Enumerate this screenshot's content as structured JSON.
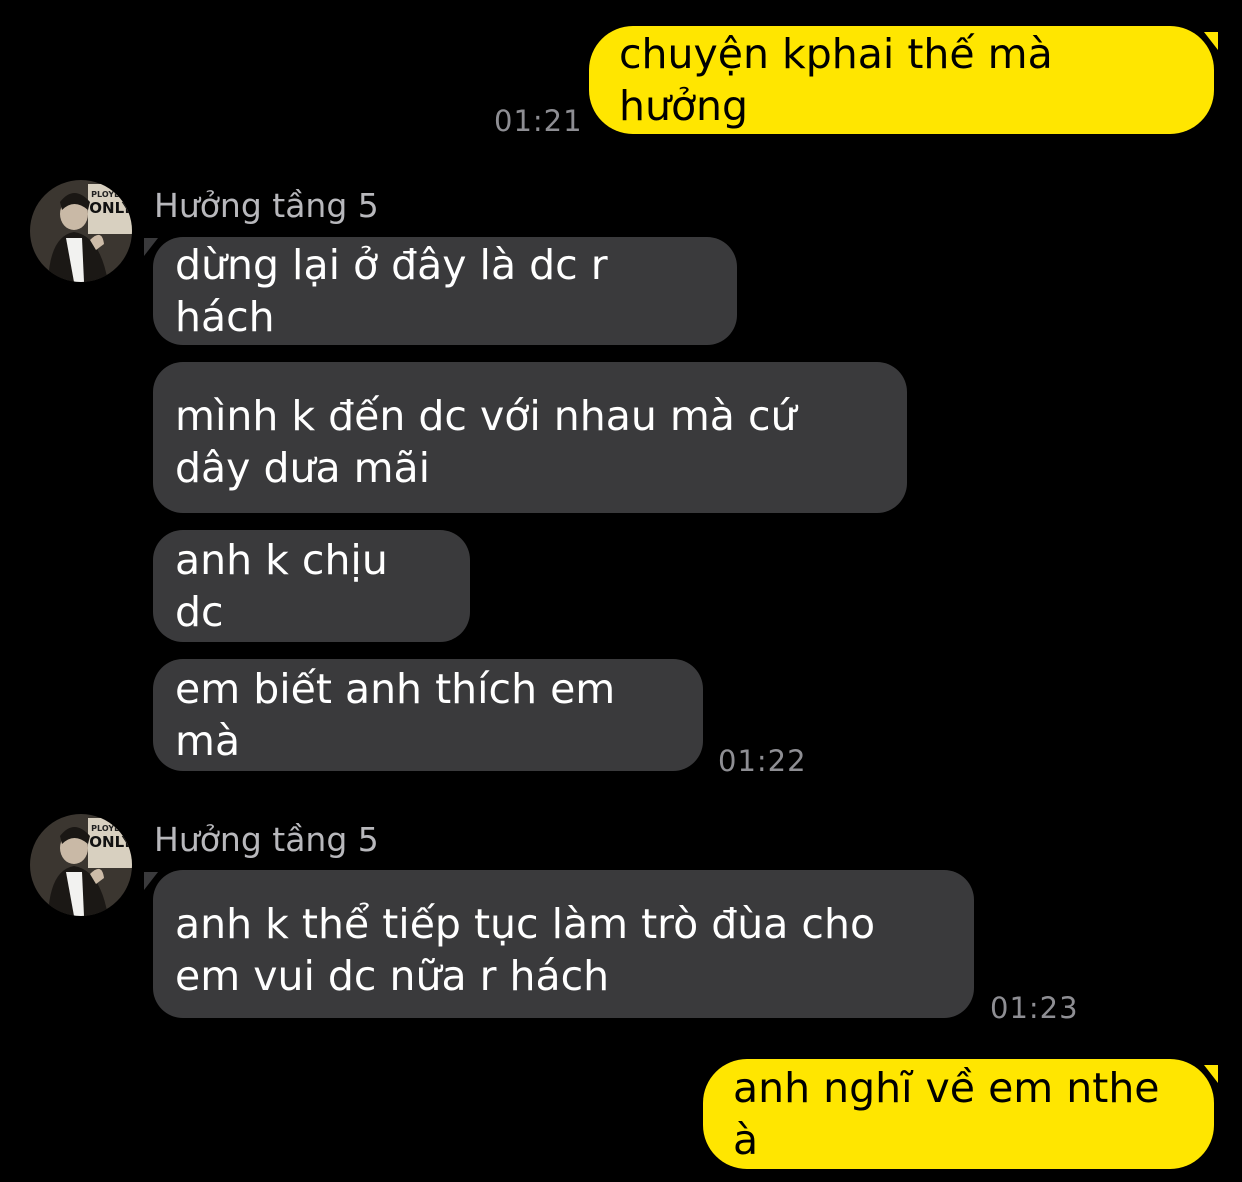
{
  "messages": [
    {
      "dir": "out",
      "text": "chuyện kphai thế mà hưởng",
      "time": "01:21"
    },
    {
      "dir": "in",
      "sender": "Hưởng tầng 5",
      "text": "dừng lại ở đây là dc r hách"
    },
    {
      "dir": "in",
      "text": "mình k đến dc với nhau mà cứ dây dưa mãi"
    },
    {
      "dir": "in",
      "text": "anh k chịu dc"
    },
    {
      "dir": "in",
      "text": "em biết anh thích em mà",
      "time": "01:22"
    },
    {
      "dir": "in",
      "sender": "Hưởng tầng 5",
      "text": "anh k thể tiếp tục làm trò đùa cho em vui dc nữa r hách",
      "time": "01:23"
    },
    {
      "dir": "out",
      "text": "anh nghĩ về em nthe à"
    }
  ],
  "avatar_badge": "ONLY",
  "avatar_badge_top": "PLOYEES",
  "colors": {
    "background": "#000000",
    "outgoing_bubble": "#ffe600",
    "incoming_bubble": "#3a3a3c",
    "timestamp": "#8e8e93"
  },
  "icons": {
    "avatar": "contact-photo"
  }
}
